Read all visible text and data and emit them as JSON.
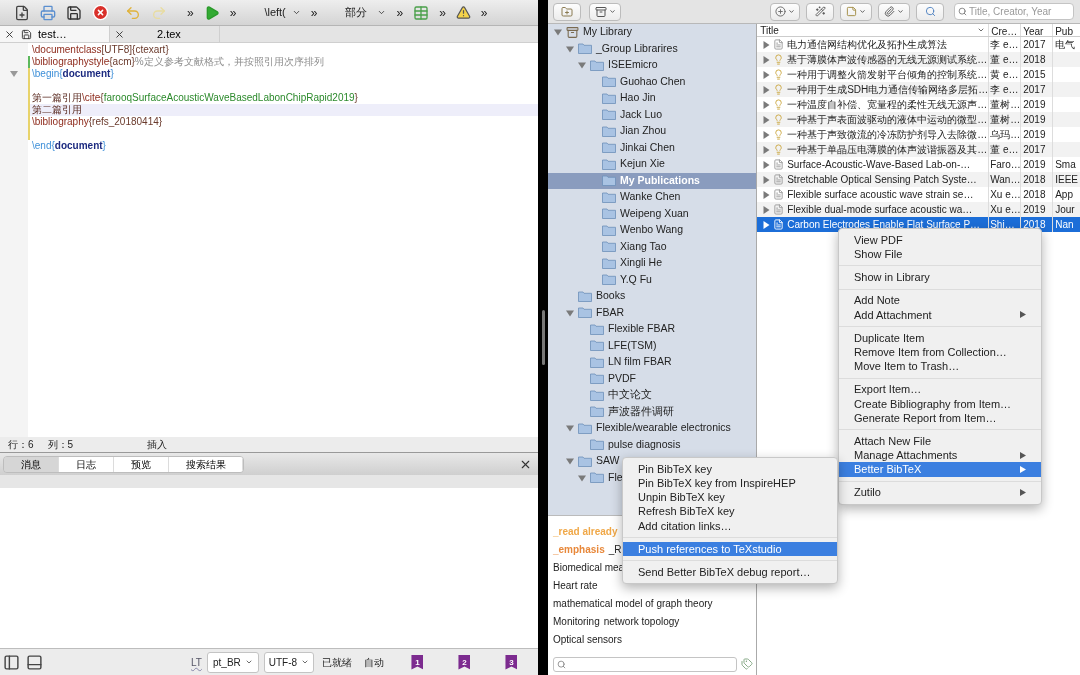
{
  "editor": {
    "toolbar": {
      "overflow": [
        "»",
        "»",
        "»",
        "»",
        "»",
        "»"
      ],
      "dropdowns": [
        "\\left(",
        "部分"
      ]
    },
    "tabs": [
      {
        "label": "test…",
        "selected": true,
        "modified": true
      },
      {
        "label": "2.tex",
        "selected": false,
        "modified": false
      }
    ],
    "lines": [
      {
        "current": false,
        "foldable": false,
        "added": false,
        "modified": false,
        "segments": [
          {
            "kind": "command",
            "text": "\\documentclass"
          },
          {
            "kind": "arg",
            "text": "[UTF8]{ctexart}"
          }
        ]
      },
      {
        "current": false,
        "foldable": false,
        "added": true,
        "modified": true,
        "segments": [
          {
            "kind": "command",
            "text": "\\bibliographystyle"
          },
          {
            "kind": "arg",
            "text": "{acm}"
          },
          {
            "kind": "comment",
            "text": "%定义参考文献格式，并按照引用次序排列"
          }
        ]
      },
      {
        "current": false,
        "foldable": true,
        "added": false,
        "modified": true,
        "segments": [
          {
            "kind": "environment",
            "text": "\\begin{"
          },
          {
            "kind": "keyword",
            "text": "document"
          },
          {
            "kind": "environment",
            "text": "}"
          }
        ]
      },
      {
        "modified": true
      },
      {
        "current": false,
        "foldable": false,
        "added": false,
        "modified": true,
        "segments": [
          {
            "kind": "text",
            "text": "第一篇引用"
          },
          {
            "kind": "command",
            "text": "\\cite"
          },
          {
            "kind": "arg",
            "text": "{"
          },
          {
            "kind": "citekey",
            "text": "farooqSurfaceAcousticWaveBasedLabonChipRapid2019"
          },
          {
            "kind": "arg",
            "text": "}"
          }
        ]
      },
      {
        "current": true,
        "foldable": false,
        "added": false,
        "modified": true,
        "segments": [
          {
            "kind": "text",
            "text": "第二篇引用"
          }
        ]
      },
      {
        "current": false,
        "foldable": false,
        "added": false,
        "modified": true,
        "segments": [
          {
            "kind": "command",
            "text": "\\bibliography"
          },
          {
            "kind": "arg",
            "text": "{refs_20180414}"
          }
        ]
      },
      {
        "modified": true
      },
      {
        "current": false,
        "foldable": false,
        "added": false,
        "modified": false,
        "segments": [
          {
            "kind": "environment",
            "text": "\\end{"
          },
          {
            "kind": "keyword",
            "text": "document"
          },
          {
            "kind": "environment",
            "text": "}"
          }
        ]
      }
    ],
    "status": {
      "line": "行：6",
      "column": "列：5",
      "mode": "插入"
    },
    "dock_tabs": [
      {
        "label": "消息",
        "selected": true
      },
      {
        "label": "日志",
        "selected": false
      },
      {
        "label": "预览",
        "selected": false
      },
      {
        "label": "搜索结果",
        "selected": false
      }
    ],
    "bottom_bar": {
      "lt": "LT",
      "language": "pt_BR",
      "encoding": "UTF-8",
      "state": "已就绪",
      "mode": "自动",
      "bookmarks": [
        "1",
        "2",
        "3"
      ]
    }
  },
  "zotero": {
    "search_placeholder": "Title, Creator, Year",
    "tree": [
      {
        "label": "My Library",
        "expanded": true,
        "selected": false,
        "children": [
          {
            "label": "_Group Librarires",
            "expanded": true,
            "selected": false,
            "children": [
              {
                "label": "ISEEmicro",
                "expanded": true,
                "selected": false,
                "children": [
                  {
                    "label": "Guohao Chen",
                    "selected": false
                  },
                  {
                    "label": "Hao Jin",
                    "selected": false
                  },
                  {
                    "label": "Jack Luo",
                    "selected": false
                  },
                  {
                    "label": "Jian Zhou",
                    "selected": false
                  },
                  {
                    "label": "Jinkai Chen",
                    "selected": false
                  },
                  {
                    "label": "Kejun Xie",
                    "selected": false
                  },
                  {
                    "label": "My Publications",
                    "selected": true
                  },
                  {
                    "label": "Wanke Chen",
                    "selected": false
                  },
                  {
                    "label": "Weipeng Xuan",
                    "selected": false
                  },
                  {
                    "label": "Wenbo Wang",
                    "selected": false
                  },
                  {
                    "label": "Xiang Tao",
                    "selected": false
                  },
                  {
                    "label": "Xingli He",
                    "selected": false
                  },
                  {
                    "label": "Y.Q Fu",
                    "selected": false
                  }
                ]
              }
            ]
          },
          {
            "label": "Books",
            "selected": false
          },
          {
            "label": "FBAR",
            "expanded": true,
            "selected": false,
            "children": [
              {
                "label": "Flexible FBAR",
                "selected": false
              },
              {
                "label": "LFE(TSM)",
                "selected": false
              },
              {
                "label": "LN film FBAR",
                "selected": false
              },
              {
                "label": "PVDF",
                "selected": false
              },
              {
                "label": "中文论文",
                "selected": false
              },
              {
                "label": "声波器件调研",
                "selected": false
              }
            ]
          },
          {
            "label": "Flexible/wearable electronics",
            "expanded": true,
            "selected": false,
            "children": [
              {
                "label": "pulse diagnosis",
                "selected": false
              }
            ]
          },
          {
            "label": "SAW",
            "expanded": true,
            "selected": false,
            "children": [
              {
                "label": "Fle",
                "expanded": true,
                "selected": false
              }
            ]
          }
        ]
      }
    ],
    "tag_rows": [
      [
        {
          "text": "_read already",
          "color": "#f0a848"
        }
      ],
      [
        {
          "text": "_emphasis",
          "color": "#e8883a"
        },
        {
          "text": "_R"
        }
      ],
      [
        {
          "text": "Biomedical mea"
        }
      ],
      [
        {
          "text": "Heart rate"
        }
      ],
      [
        {
          "text": "mathematical model of graph theory"
        }
      ],
      [
        {
          "text": "Monitoring"
        },
        {
          "text": "network topology"
        }
      ],
      [
        {
          "text": "Optical sensors"
        }
      ]
    ],
    "columns": [
      "Title",
      "Cre…",
      "Year",
      "Pub"
    ],
    "rows": [
      {
        "kind": "document",
        "title": "电力通信网结构优化及拓扑生成算法",
        "creator": "李 e…",
        "year": "2017",
        "publication": "电气",
        "selected": false
      },
      {
        "kind": "patent",
        "title": "基于薄膜体声波传感器的无线无源测试系统…",
        "creator": "董 e…",
        "year": "2018",
        "selected": false
      },
      {
        "kind": "patent",
        "title": "一种用于调整火箭发射平台倾角的控制系统…",
        "creator": "黄 e…",
        "year": "2015",
        "selected": false
      },
      {
        "kind": "patent",
        "title": "一种用于生成SDH电力通信传输网络多层拓…",
        "creator": "李 e…",
        "year": "2017",
        "selected": false
      },
      {
        "kind": "patent",
        "title": "一种温度自补偿、宽量程的柔性无线无源声…",
        "creator": "董树…",
        "year": "2019",
        "selected": false
      },
      {
        "kind": "patent",
        "title": "一种基于声表面波驱动的液体中运动的微型…",
        "creator": "董树…",
        "year": "2019",
        "selected": false
      },
      {
        "kind": "patent",
        "title": "一种基于声致微流的冷冻防护剂导入去除微…",
        "creator": "乌玛…",
        "year": "2019",
        "selected": false
      },
      {
        "kind": "patent",
        "title": "一种基于单晶压电薄膜的体声波谐振器及其…",
        "creator": "董 e…",
        "year": "2017",
        "selected": false
      },
      {
        "kind": "document",
        "title": "Surface-Acoustic-Wave-Based Lab-on-…",
        "creator": "Faro…",
        "year": "2019",
        "publication": "Sma",
        "selected": false
      },
      {
        "kind": "document",
        "title": "Stretchable Optical Sensing Patch Syste…",
        "creator": "Wan…",
        "year": "2018",
        "publication": "IEEE",
        "selected": false
      },
      {
        "kind": "document",
        "title": "Flexible surface acoustic wave strain se…",
        "creator": "Xu e…",
        "year": "2018",
        "publication": "App",
        "selected": false
      },
      {
        "kind": "document",
        "title": "Flexible dual-mode surface acoustic wa…",
        "creator": "Xu e…",
        "year": "2019",
        "publication": "Jour",
        "selected": false
      },
      {
        "kind": "document",
        "title": "Carbon Electrodes Enable Flat Surface P…",
        "creator": "Shi…",
        "year": "2018",
        "publication": "Nan",
        "selected": true
      }
    ],
    "context_menu": [
      [
        {
          "label": "View PDF",
          "submenu": false,
          "selected": false
        },
        {
          "label": "Show File",
          "submenu": false,
          "selected": false
        }
      ],
      [
        {
          "label": "Show in Library",
          "submenu": false,
          "selected": false
        }
      ],
      [
        {
          "label": "Add Note",
          "submenu": false,
          "selected": false
        },
        {
          "label": "Add Attachment",
          "submenu": true,
          "selected": false
        }
      ],
      [
        {
          "label": "Duplicate Item",
          "submenu": false,
          "selected": false
        },
        {
          "label": "Remove Item from Collection…",
          "submenu": false,
          "selected": false
        },
        {
          "label": "Move Item to Trash…",
          "submenu": false,
          "selected": false
        }
      ],
      [
        {
          "label": "Export Item…",
          "submenu": false,
          "selected": false
        },
        {
          "label": "Create Bibliography from Item…",
          "submenu": false,
          "selected": false
        },
        {
          "label": "Generate Report from Item…",
          "submenu": false,
          "selected": false
        }
      ],
      [
        {
          "label": "Attach New File",
          "submenu": false,
          "selected": false
        },
        {
          "label": "Manage Attachments",
          "submenu": true,
          "selected": false
        },
        {
          "label": "Better BibTeX",
          "submenu": true,
          "selected": true
        }
      ],
      [
        {
          "label": "Zutilo",
          "submenu": true,
          "selected": false
        }
      ]
    ],
    "submenu": [
      [
        {
          "label": "Pin BibTeX key",
          "submenu": false,
          "selected": false
        },
        {
          "label": "Pin BibTeX key from InspireHEP",
          "submenu": false,
          "selected": false
        },
        {
          "label": "Unpin BibTeX key",
          "submenu": false,
          "selected": false
        },
        {
          "label": "Refresh BibTeX key",
          "submenu": false,
          "selected": false
        },
        {
          "label": "Add citation links…",
          "submenu": false,
          "selected": false
        }
      ],
      [
        {
          "label": "Push references to TeXstudio",
          "submenu": false,
          "selected": true
        }
      ],
      [
        {
          "label": "Send Better BibTeX debug report…",
          "submenu": false,
          "selected": false
        }
      ]
    ]
  }
}
